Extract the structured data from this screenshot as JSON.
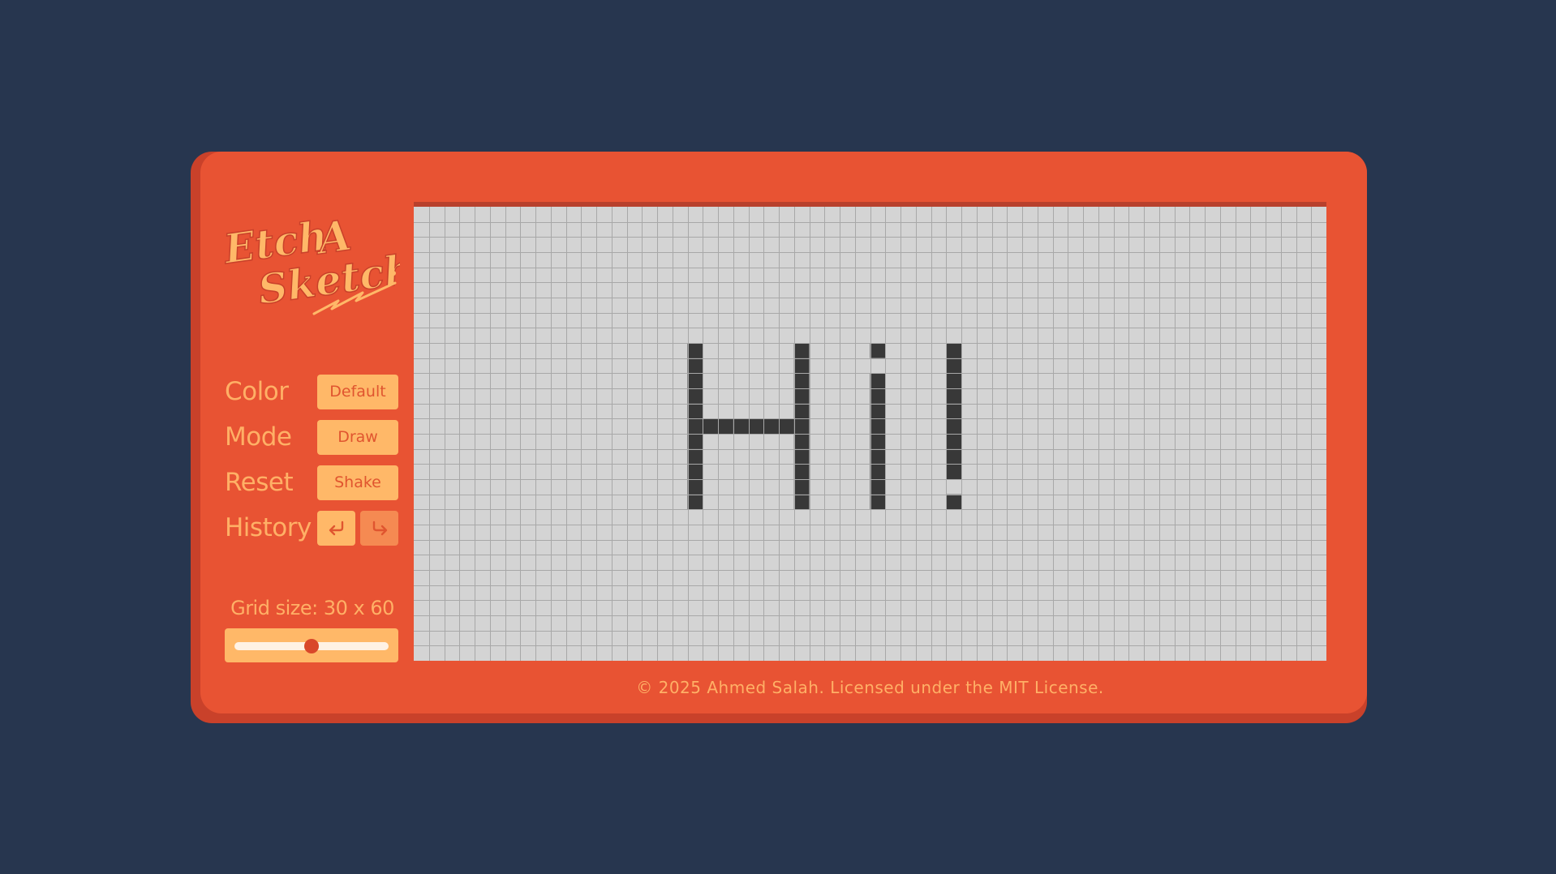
{
  "app": {
    "logo_text": "Etch A Sketch"
  },
  "controls": {
    "color": {
      "label": "Color",
      "button": "Default"
    },
    "mode": {
      "label": "Mode",
      "button": "Draw"
    },
    "reset": {
      "label": "Reset",
      "button": "Shake"
    },
    "history": {
      "label": "History",
      "undo_icon": "undo-arrow-icon",
      "redo_icon": "redo-arrow-icon",
      "redo_enabled": false
    }
  },
  "grid": {
    "size_text": "Grid size: 30 x 60",
    "rows": 30,
    "cols": 60,
    "slider_fraction": 0.5,
    "cell_color": "#d4d4d4",
    "line_color": "#a8a8a8",
    "ink_color": "#383838",
    "filled_cells": [
      [
        9,
        18
      ],
      [
        10,
        18
      ],
      [
        11,
        18
      ],
      [
        12,
        18
      ],
      [
        13,
        18
      ],
      [
        14,
        18
      ],
      [
        15,
        18
      ],
      [
        16,
        18
      ],
      [
        17,
        18
      ],
      [
        18,
        18
      ],
      [
        19,
        18
      ],
      [
        9,
        25
      ],
      [
        10,
        25
      ],
      [
        11,
        25
      ],
      [
        12,
        25
      ],
      [
        13,
        25
      ],
      [
        14,
        25
      ],
      [
        15,
        25
      ],
      [
        16,
        25
      ],
      [
        17,
        25
      ],
      [
        18,
        25
      ],
      [
        19,
        25
      ],
      [
        14,
        19
      ],
      [
        14,
        20
      ],
      [
        14,
        21
      ],
      [
        14,
        22
      ],
      [
        14,
        23
      ],
      [
        14,
        24
      ],
      [
        9,
        30
      ],
      [
        11,
        30
      ],
      [
        12,
        30
      ],
      [
        13,
        30
      ],
      [
        14,
        30
      ],
      [
        15,
        30
      ],
      [
        16,
        30
      ],
      [
        17,
        30
      ],
      [
        18,
        30
      ],
      [
        19,
        30
      ],
      [
        9,
        35
      ],
      [
        10,
        35
      ],
      [
        11,
        35
      ],
      [
        12,
        35
      ],
      [
        13,
        35
      ],
      [
        14,
        35
      ],
      [
        15,
        35
      ],
      [
        16,
        35
      ],
      [
        17,
        35
      ],
      [
        19,
        35
      ]
    ]
  },
  "colors": {
    "background": "#27364f",
    "device": "#e85333",
    "accent": "#ffb868",
    "label": "#ffb066"
  },
  "footer": {
    "text": "© 2025 Ahmed Salah. Licensed under the MIT License."
  }
}
